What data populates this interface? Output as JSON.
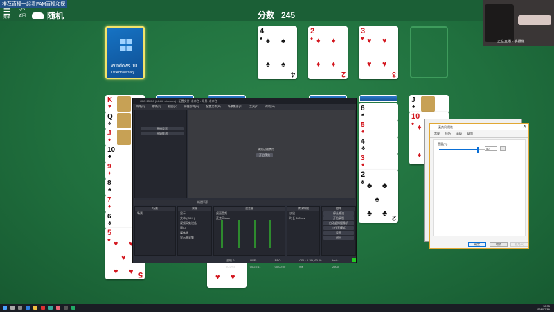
{
  "overlay_text": "推荐直播一起看FAM直播和探",
  "header": {
    "menu_label": "菜单",
    "back_label": "返回",
    "game_title": "随机",
    "score_label": "分数",
    "score_value": "245"
  },
  "webcam": {
    "caption": "正在直播 · 手摄像"
  },
  "stock": {
    "line1": "Windows 10",
    "line2": "1st Anniversary"
  },
  "foundations": [
    {
      "rank": "4",
      "suit": "♠",
      "color": "blk"
    },
    {
      "rank": "2",
      "suit": "♦",
      "color": "red"
    },
    {
      "rank": "3",
      "suit": "♥",
      "color": "red"
    }
  ],
  "tableau_left": [
    {
      "rank": "K",
      "suit": "♥",
      "color": "red"
    },
    {
      "rank": "Q",
      "suit": "♠",
      "color": "blk"
    },
    {
      "rank": "J",
      "suit": "♦",
      "color": "red"
    },
    {
      "rank": "10",
      "suit": "♣",
      "color": "blk"
    },
    {
      "rank": "9",
      "suit": "♦",
      "color": "red"
    },
    {
      "rank": "8",
      "suit": "♣",
      "color": "blk"
    },
    {
      "rank": "7",
      "suit": "♦",
      "color": "red"
    },
    {
      "rank": "6",
      "suit": "♣",
      "color": "blk"
    },
    {
      "rank": "5",
      "suit": "♥",
      "color": "red"
    }
  ],
  "tableau_mid": [
    {
      "rank": "6",
      "suit": "♠",
      "color": "blk"
    },
    {
      "rank": "5",
      "suit": "♦",
      "color": "red"
    },
    {
      "rank": "4",
      "suit": "♣",
      "color": "blk"
    },
    {
      "rank": "3",
      "suit": "♦",
      "color": "red"
    },
    {
      "rank": "2",
      "suit": "♣",
      "color": "blk"
    }
  ],
  "tableau_right": [
    {
      "rank": "J",
      "suit": "♠",
      "color": "blk"
    },
    {
      "rank": "10",
      "suit": "♦",
      "color": "red"
    }
  ],
  "bottom_card": {
    "rank": "",
    "suit": "♥",
    "color": "red"
  },
  "obs": {
    "title": "OBS 25.0.8 (64-bit, windows) - 配置文件: 未命名 - 场景: 未命名",
    "menu": [
      "文件(F)",
      "编辑(E)",
      "视图(V)",
      "停靠部件(D)",
      "配置文件(P)",
      "场景集合(S)",
      "工具(T)",
      "帮助(H)"
    ],
    "left_buttons": [
      "直播设置",
      "开始推流"
    ],
    "preview_text": "预览已被禁用",
    "preview_button": "开启预览",
    "bar_label": "未选择源",
    "docks": [
      {
        "title": "场景",
        "items": [
          "场景"
        ]
      },
      {
        "title": "来源",
        "items": [
          "显示",
          "文本 (GDI+)",
          "视频采集设备",
          "窗口",
          "媒体源",
          "显示器采集"
        ]
      },
      {
        "title": "混音器",
        "items": [
          "桌面音频",
          "麦克风/Aux"
        ]
      },
      {
        "title": "转场特效",
        "items": [
          "淡出",
          "时长 300 ms"
        ]
      },
      {
        "title": "控件",
        "items": [
          "停止推流",
          "开始录制",
          "启动虚拟摄像机",
          "工作室模式",
          "设置",
          "退出"
        ]
      }
    ],
    "status": [
      "丢帧 0 (0.0%)",
      "LIVE: 00:23:41",
      "REC: 00:00:00",
      "CPU: 1.3%, 60.00 fps",
      "kb/s: 2500"
    ]
  },
  "dialog": {
    "title": "麦克风 属性",
    "tabs": [
      "常规",
      "侦听",
      "高级",
      "级别"
    ],
    "slider_label": "音量(V):",
    "slider_value": "50",
    "slider_fraction": 0.7,
    "ok": "确定",
    "cancel": "取消",
    "apply": "应用(A)"
  },
  "taskbar": {
    "time": "18:35",
    "date": "2020/7/16"
  }
}
